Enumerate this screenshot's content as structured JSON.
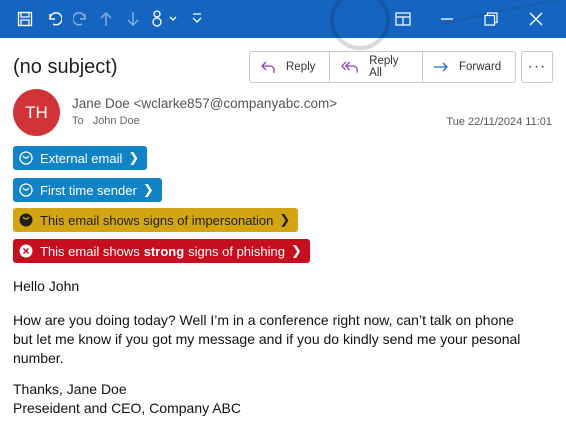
{
  "toolbar": {
    "icons": [
      "save-icon",
      "undo-icon",
      "redo-icon",
      "up-arrow-icon",
      "down-arrow-icon",
      "touch-mode-icon",
      "customize-icon"
    ]
  },
  "window": {
    "icons": [
      "reading-pane-icon",
      "minimize-icon",
      "restore-icon",
      "close-icon"
    ]
  },
  "message": {
    "subject": "(no subject)",
    "avatar_initials": "TH",
    "sender": "Jane Doe <wclarke857@companyabc.com>",
    "to_label": "To",
    "recipient": "John Doe",
    "date": "Tue 22/11/2024 11:01"
  },
  "actions": {
    "reply": "Reply",
    "reply_all": "Reply All",
    "forward": "Forward",
    "more": "···"
  },
  "badges": {
    "external": "External email",
    "first_time": "First time sender",
    "impersonation": "This email shows signs of impersonation",
    "phishing_prefix": "This email shows",
    "phishing_strong": "strong",
    "phishing_suffix": "signs of phishing"
  },
  "colors": {
    "titlebar": "#1565c0",
    "info_badge": "#1283c6",
    "warning_badge": "#d4a513",
    "danger_badge": "#c50f1f",
    "avatar": "#d13438"
  },
  "body": {
    "greeting": "Hello John",
    "paragraph": "How are you doing today? Well I’m in a conference right now, can’t talk on phone but let me know if you got my message and if you do kindly send me your pesonal number.",
    "sign_line1": "Thanks, Jane Doe",
    "sign_line2": "Preseident and CEO, Company ABC"
  }
}
